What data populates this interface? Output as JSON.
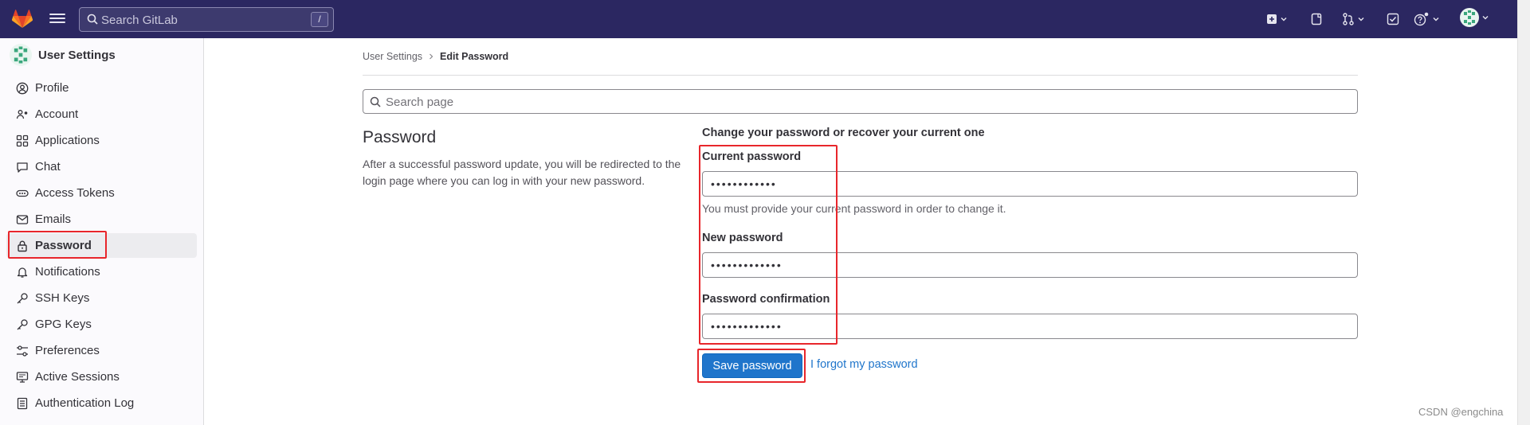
{
  "topbar": {
    "search_placeholder": "Search GitLab",
    "search_shortcut": "/",
    "icons": [
      "create-new-icon",
      "issues-icon",
      "merge-requests-icon",
      "todos-icon",
      "help-icon",
      "user-avatar"
    ]
  },
  "sidebar": {
    "title": "User Settings",
    "items": [
      {
        "label": "Profile",
        "icon": "profile-icon"
      },
      {
        "label": "Account",
        "icon": "account-icon"
      },
      {
        "label": "Applications",
        "icon": "applications-icon"
      },
      {
        "label": "Chat",
        "icon": "chat-icon"
      },
      {
        "label": "Access Tokens",
        "icon": "token-icon"
      },
      {
        "label": "Emails",
        "icon": "mail-icon"
      },
      {
        "label": "Password",
        "icon": "lock-icon",
        "active": true
      },
      {
        "label": "Notifications",
        "icon": "bell-icon"
      },
      {
        "label": "SSH Keys",
        "icon": "key-icon"
      },
      {
        "label": "GPG Keys",
        "icon": "key-icon"
      },
      {
        "label": "Preferences",
        "icon": "preferences-icon"
      },
      {
        "label": "Active Sessions",
        "icon": "monitor-icon"
      },
      {
        "label": "Authentication Log",
        "icon": "log-icon"
      }
    ]
  },
  "breadcrumb": {
    "parent": "User Settings",
    "current": "Edit Password"
  },
  "page_search": {
    "placeholder": "Search page"
  },
  "section": {
    "title": "Password",
    "description": "After a successful password update, you will be redirected to the login page where you can log in with your new password."
  },
  "form": {
    "heading": "Change your password or recover your current one",
    "current_label": "Current password",
    "current_value": "••••••••••••",
    "current_help": "You must provide your current password in order to change it.",
    "new_label": "New password",
    "new_value": "•••••••••••••",
    "confirm_label": "Password confirmation",
    "confirm_value": "•••••••••••••",
    "save_label": "Save password",
    "forgot_label": "I forgot my password"
  },
  "colors": {
    "topbar": "#2b2761",
    "primary": "#1f75cb",
    "annotation": "#e8262b"
  },
  "watermark": "CSDN @engchina"
}
